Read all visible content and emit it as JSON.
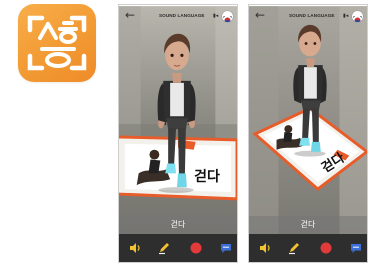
{
  "app_icon": {
    "name": "camera-hangul-app-icon",
    "glyph": "ㅅㅎ"
  },
  "screens": [
    {
      "top_bar": {
        "back_label": "←",
        "sound_language_label": "SOUND LANGUAGE",
        "speaker_icon": "speaker-small-icon",
        "flag_icon": "korea-flag-icon"
      },
      "card_word": "걷다",
      "word_label": "걷다",
      "toolbar": [
        "speaker-icon",
        "pencil-icon",
        "record-icon",
        "chat-bubble-icon"
      ]
    },
    {
      "top_bar": {
        "back_label": "←",
        "sound_language_label": "SOUND LANGUAGE",
        "speaker_icon": "speaker-small-icon",
        "flag_icon": "korea-flag-icon"
      },
      "card_word": "걷다",
      "word_label": "걷다",
      "toolbar": [
        "speaker-icon",
        "pencil-icon",
        "record-icon",
        "chat-bubble-icon"
      ]
    }
  ],
  "colors": {
    "icon_orange": "#f29a33",
    "toolbar_bg": "#2e2e2e",
    "card_border": "#e85c2a",
    "speaker_yellow": "#f2c230",
    "record_red": "#e23a3a",
    "chat_blue": "#3c6fd8"
  }
}
